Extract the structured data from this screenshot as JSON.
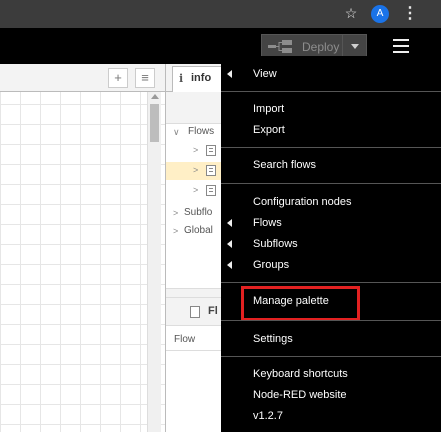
{
  "browser": {
    "star_icon": "star-icon",
    "avatar_letter": "A",
    "menu_icon": "kebab-menu-icon"
  },
  "header": {
    "deploy_label": "Deploy",
    "deploy_icon": "deploy-flows-icon",
    "menu_icon": "hamburger-menu-icon"
  },
  "workspace": {
    "add_icon": "+",
    "list_icon": "≡"
  },
  "sidebar": {
    "tab_icon": "i",
    "tab_label": "info",
    "tree": [
      {
        "label": "Flows",
        "caret": "∨"
      },
      {
        "label": "",
        "caret": ">"
      },
      {
        "label": "",
        "caret": ">"
      },
      {
        "label": "",
        "caret": ">"
      },
      {
        "label": "Subflo",
        "caret": ">"
      },
      {
        "label": "Global",
        "caret": ">"
      }
    ],
    "flow_header_label": "Fl",
    "flow_prop_label": "Flow"
  },
  "menu": {
    "items": [
      {
        "label": "View",
        "submenu": true
      },
      {
        "label": "Import",
        "submenu": false
      },
      {
        "label": "Export",
        "submenu": false
      },
      {
        "label": "Search flows",
        "submenu": false
      },
      {
        "label": "Configuration nodes",
        "submenu": false
      },
      {
        "label": "Flows",
        "submenu": true
      },
      {
        "label": "Subflows",
        "submenu": true
      },
      {
        "label": "Groups",
        "submenu": true
      },
      {
        "label": "Manage palette",
        "submenu": false
      },
      {
        "label": "Settings",
        "submenu": false
      },
      {
        "label": "Keyboard shortcuts",
        "submenu": false
      },
      {
        "label": "Node-RED website",
        "submenu": false
      },
      {
        "label": "v1.2.7",
        "submenu": false
      }
    ],
    "highlight_color": "#e32121"
  }
}
